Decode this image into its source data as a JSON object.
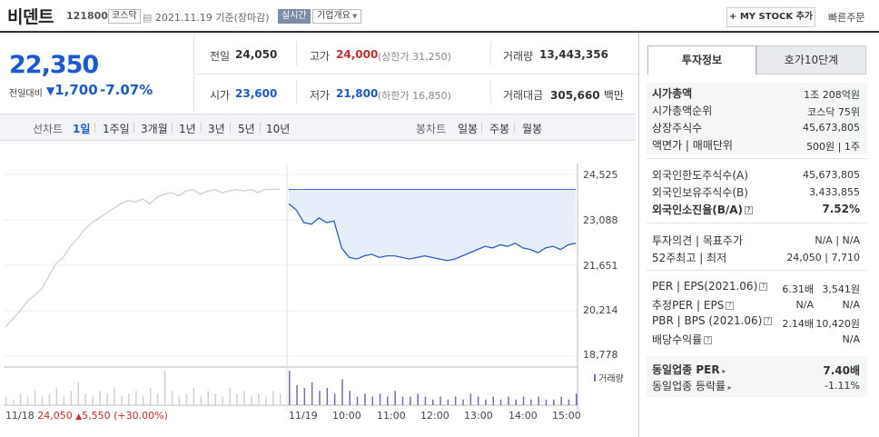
{
  "header": {
    "name": "비덴트",
    "code": "121800",
    "market": "코스닥",
    "date": "2021.11.19",
    "basis": "기준(장마감)",
    "live_label": "실시간",
    "corp_info": "기업개요",
    "mystock_label": "+ MY STOCK 추가",
    "quick_order": "빠른주문"
  },
  "price": {
    "current": "22,350",
    "change_label": "전일대비",
    "change": "1,700",
    "change_pct": "-7.07%"
  },
  "summary": {
    "prev_label": "전일",
    "prev": "24,050",
    "high_label": "고가",
    "high": "24,000",
    "upper_limit": "(상한가 31,250)",
    "volume_label": "거래량",
    "volume": "13,443,356",
    "open_label": "시가",
    "open": "23,600",
    "low_label": "저가",
    "low": "21,800",
    "lower_limit": "(하한가 16,850)",
    "amount_label": "거래대금",
    "amount": "305,660",
    "amount_unit": "백만"
  },
  "periods": {
    "line_label": "선차트",
    "line_items": [
      "1일",
      "1주일",
      "3개월",
      "1년",
      "3년",
      "5년",
      "10년"
    ],
    "active": "1일",
    "candle_label": "봉차트",
    "candle_items": [
      "일봉",
      "주봉",
      "월봉"
    ]
  },
  "chart_data": {
    "type": "line",
    "y_ticks": [
      "24,525",
      "23,088",
      "21,651",
      "20,214",
      "18,778"
    ],
    "ylim": [
      18778,
      24525
    ],
    "x_ticks": [
      "11/19",
      "10:00",
      "11:00",
      "12:00",
      "13:00",
      "14:00",
      "15:00"
    ],
    "volume_legend": "거래량",
    "prev_day_series": {
      "name": "11/18",
      "values": [
        19700,
        19950,
        20200,
        20500,
        20700,
        20900,
        21300,
        21700,
        21900,
        22250,
        22500,
        22800,
        23000,
        23150,
        23300,
        23450,
        23600,
        23700,
        23650,
        23750,
        23600,
        23800,
        23900,
        23950,
        23850,
        24000,
        24050,
        23900,
        24000,
        24050,
        23950,
        24000,
        24050,
        24000,
        24050,
        23950,
        24050,
        24050,
        24050
      ]
    },
    "today_series": {
      "name": "11/19",
      "values": [
        23600,
        23400,
        23000,
        22950,
        23150,
        23000,
        23050,
        22200,
        21900,
        21850,
        21950,
        22000,
        21900,
        21950,
        21950,
        21900,
        21850,
        21900,
        21950,
        21900,
        21850,
        21800,
        21850,
        21950,
        22050,
        22150,
        22250,
        22200,
        22300,
        22250,
        22350,
        22200,
        22150,
        22050,
        22200,
        22250,
        22150,
        22300,
        22350
      ]
    },
    "prev_volume": [
      3,
      2,
      4,
      3,
      5,
      3,
      4,
      6,
      3,
      5,
      8,
      4,
      3,
      5,
      4,
      6,
      3,
      4,
      5,
      3,
      6,
      4,
      12,
      5,
      3,
      4,
      6,
      3,
      5,
      4,
      3,
      6,
      4,
      5,
      3,
      4,
      3,
      5,
      4
    ],
    "today_volume": [
      12,
      7,
      6,
      8,
      5,
      6,
      4,
      9,
      5,
      3,
      4,
      3,
      4,
      3,
      5,
      3,
      3,
      4,
      3,
      2,
      3,
      2,
      3,
      2,
      4,
      3,
      2,
      3,
      2,
      3,
      2,
      3,
      2,
      3,
      2,
      2,
      3,
      2,
      4
    ]
  },
  "prev_close_summary": {
    "date": "11/18",
    "price": "24,050",
    "change": "5,550",
    "pct": "(+30.00%)"
  },
  "right_panel": {
    "tab_invest": "투자정보",
    "tab_hoga": "호가10단계",
    "rows1": [
      {
        "label": "시가총액",
        "value": "1조 208억원"
      },
      {
        "label": "시가총액순위",
        "value": "코스닥 75위"
      },
      {
        "label": "상장주식수",
        "value": "45,673,805"
      },
      {
        "label": "액면가 | 매매단위",
        "value": "500원 | 1주"
      }
    ],
    "rows2": [
      {
        "label": "외국인한도주식수(A)",
        "value": "45,673,805"
      },
      {
        "label": "외국인보유주식수(B)",
        "value": "3,433,855"
      },
      {
        "label": "외국인소진율(B/A)",
        "value": "7.52%"
      }
    ],
    "rows3": [
      {
        "label": "투자의견 | 목표주가",
        "value": "N/A | N/A"
      },
      {
        "label": "52주최고 | 최저",
        "value": "24,050 | 7,710"
      }
    ],
    "rows4": [
      {
        "label": "PER | EPS(2021.06)",
        "value1": "6.31배",
        "value2": "3,541원"
      },
      {
        "label": "추정PER | EPS",
        "value1": "N/A",
        "value2": "N/A"
      },
      {
        "label": "PBR | BPS (2021.06)",
        "value1": "2.14배",
        "value2": "10,420원"
      },
      {
        "label": "배당수익률",
        "value1": "",
        "value2": "N/A"
      }
    ],
    "rows5": [
      {
        "label": "동일업종 PER",
        "value": "7.40배"
      },
      {
        "label": "동일업종 등락률",
        "value": "-1.11%"
      }
    ]
  }
}
